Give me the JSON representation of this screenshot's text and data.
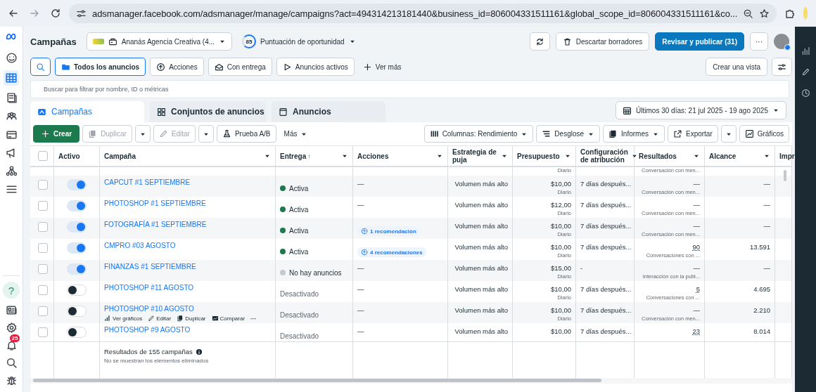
{
  "browser": {
    "url": "adsmanager.facebook.com/adsmanager/manage/campaigns?act=494314213181440&business_id=806004331511161&global_scope_id=806004331511161&co..."
  },
  "nav": {
    "help": "?",
    "badge": "25"
  },
  "header": {
    "title": "Campañas",
    "account": "Ananás Agencia Creativa (4...",
    "score": "85",
    "score_label": "Puntuación de oportunidad",
    "discard": "Descartar borradores",
    "publish": "Revisar y publicar (31)",
    "more": "···"
  },
  "filters": {
    "chips": [
      {
        "label": "Todos los anuncios",
        "selected": true
      },
      {
        "label": "Acciones",
        "selected": false
      },
      {
        "label": "Con entrega",
        "selected": false
      },
      {
        "label": "Anuncios activos",
        "selected": false
      }
    ],
    "more": "Ver más",
    "create_view": "Crear una vista"
  },
  "search": {
    "placeholder": "Buscar para filtrar por nombre, ID o métricas"
  },
  "tabs": [
    {
      "label": "Campañas",
      "selected": true
    },
    {
      "label": "Conjuntos de anuncios",
      "selected": false
    },
    {
      "label": "Anuncios",
      "selected": false
    }
  ],
  "date_range": "Últimos 30 días: 21 jul 2025 - 19 ago 2025",
  "toolbar": {
    "left": [
      {
        "kind": "primary",
        "label": "Crear",
        "disabled": false,
        "dropdown": false
      },
      {
        "kind": "button",
        "label": "Duplicar",
        "disabled": true,
        "dropdown": false
      },
      {
        "kind": "caret",
        "disabled": false
      },
      {
        "kind": "button",
        "label": "Editar",
        "disabled": true,
        "dropdown": false
      },
      {
        "kind": "caret",
        "disabled": false
      },
      {
        "kind": "button",
        "label": "Prueba A/B",
        "disabled": false,
        "dropdown": false
      },
      {
        "kind": "plain",
        "label": "Más",
        "disabled": false,
        "dropdown": true
      }
    ],
    "right": [
      {
        "kind": "button",
        "label": "Columnas: Rendimiento",
        "disabled": false,
        "dropdown": true
      },
      {
        "kind": "button",
        "label": "Desglose",
        "disabled": false,
        "dropdown": true
      },
      {
        "kind": "button",
        "label": "Informes",
        "disabled": false,
        "dropdown": true
      },
      {
        "kind": "button",
        "label": "Exportar",
        "disabled": false,
        "dropdown": false
      },
      {
        "kind": "caret",
        "disabled": false
      },
      {
        "kind": "button",
        "label": "Gráficos",
        "disabled": false,
        "dropdown": false
      }
    ]
  },
  "table": {
    "all_checked": false,
    "columns": [
      {
        "label": "Activo",
        "dropdown": false
      },
      {
        "label": "Campaña",
        "dropdown": true
      },
      {
        "label": "Entrega",
        "sort_arrow": "↑",
        "dropdown": true
      },
      {
        "label": "Acciones",
        "dropdown": true
      },
      {
        "label": "Estrategia de puja",
        "dropdown": true
      },
      {
        "label": "Presupuesto",
        "dropdown": true
      },
      {
        "label": "Configuración de atribución",
        "dropdown": true
      },
      {
        "label": "Resultados",
        "dropdown": true
      },
      {
        "label": "Alcance",
        "dropdown": true
      },
      {
        "label": "Impr",
        "dropdown": false
      }
    ],
    "partial_row": {
      "budget_note": "Diario",
      "result_note": "Conversación con men..."
    },
    "rows": [
      {
        "checked": false,
        "name": "CAPCUT #1 SEPTIEMBRE",
        "on": true,
        "delivery": {
          "kind": "active",
          "text": "Activa"
        },
        "actions": {
          "kind": "none",
          "text": "—"
        },
        "bid": "Volumen más alto",
        "budget": "$10,00",
        "budget_note": "Diario",
        "attribution": "7 días después...",
        "result": "—",
        "result_linked": false,
        "result_note": "Conversación con men...",
        "reach": "—"
      },
      {
        "checked": false,
        "name": "PHOTOSHOP #1 SEPTIEMBRE",
        "on": true,
        "delivery": {
          "kind": "active",
          "text": "Activa"
        },
        "actions": {
          "kind": "none",
          "text": "—"
        },
        "bid": "Volumen más alto",
        "budget": "$12,00",
        "budget_note": "Diario",
        "attribution": "7 días después...",
        "result": "—",
        "result_linked": false,
        "result_note": "Conversación con men...",
        "reach": "—"
      },
      {
        "checked": false,
        "name": "FOTOGRAFÍA #1 SEPTIEMBRE",
        "on": true,
        "delivery": {
          "kind": "active",
          "text": "Activa"
        },
        "actions": {
          "kind": "recommendation",
          "text": "1 recomendación"
        },
        "bid": "Volumen más alto",
        "budget": "$10,00",
        "budget_note": "Diario",
        "attribution": "7 días después...",
        "result": "—",
        "result_linked": false,
        "result_note": "Conversación con men...",
        "reach": "—"
      },
      {
        "checked": false,
        "name": "CMPRO #03 AGOSTO",
        "on": true,
        "delivery": {
          "kind": "active",
          "text": "Activa"
        },
        "actions": {
          "kind": "recommendation",
          "text": "4 recomendaciones"
        },
        "bid": "Volumen más alto",
        "budget": "$10,00",
        "budget_note": "Diario",
        "attribution": "7 días después...",
        "result": "90",
        "result_linked": true,
        "result_note": "Conversaciones con ...",
        "reach": "13.591"
      },
      {
        "checked": false,
        "name": "FINANZAS #1 SEPTIEMBRE",
        "on": true,
        "delivery": {
          "kind": "no_ads",
          "text": "No hay anuncios"
        },
        "actions": {
          "kind": "none",
          "text": "—"
        },
        "bid": "Volumen más alto",
        "budget": "$15,00",
        "budget_note": "Diario",
        "attribution": "-",
        "result": "—",
        "result_linked": false,
        "result_note": "Interacción con la publ...",
        "reach": "—"
      },
      {
        "checked": false,
        "name": "PHOTOSHOP #11 AGOSTO",
        "on": false,
        "delivery": {
          "kind": "off",
          "text": "Desactivado"
        },
        "actions": {
          "kind": "none",
          "text": "—"
        },
        "bid": "Volumen más alto",
        "budget": "$10,00",
        "budget_note": "Diario",
        "attribution": "7 días después...",
        "result": "5",
        "result_linked": true,
        "result_note": "Conversaciones con ...",
        "reach": "4.695"
      },
      {
        "checked": false,
        "name": "PHOTOSHOP #10 AGOSTO",
        "on": false,
        "delivery": {
          "kind": "off",
          "text": "Desactivado"
        },
        "actions": {
          "kind": "none",
          "text": "—"
        },
        "bid": "Volumen más alto",
        "budget": "$10,00",
        "budget_note": "Diario",
        "attribution": "7 días después...",
        "result": "—",
        "result_linked": false,
        "result_note": "Conversación con men...",
        "reach": "2.210",
        "quick_actions": [
          "Ver gráficos",
          "Editar",
          "Duplicar",
          "Comparar"
        ],
        "quick_more": "···"
      },
      {
        "checked": false,
        "name": "PHOTOSHOP #9 AGOSTO",
        "on": false,
        "delivery": {
          "kind": "off",
          "text": "Desactivado"
        },
        "actions": {
          "kind": "none",
          "text": "—"
        },
        "bid": "Volumen más alto",
        "budget": "$10,00",
        "attribution": "7 días después...",
        "result": "23",
        "result_linked": true,
        "reach": "8.014"
      }
    ],
    "footer": {
      "summary": "Resultados de 155 campañas",
      "note": "No se muestran los elementos eliminados"
    }
  }
}
